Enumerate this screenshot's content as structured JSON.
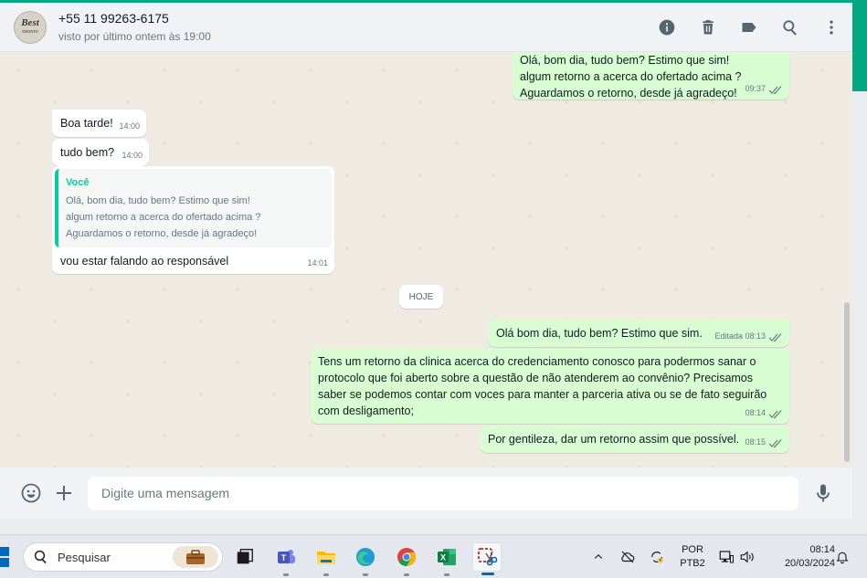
{
  "header": {
    "contact_name": "+55 11 99263-6175",
    "last_seen": "visto por último ontem às 19:00",
    "avatar_text": "Best",
    "avatar_sub": "ODONTO",
    "actions": [
      "info-icon",
      "delete-icon",
      "label-icon",
      "search-icon",
      "menu-icon"
    ]
  },
  "messages": [
    {
      "id": "m1",
      "direction": "out",
      "text": "Olá, bom dia, tudo bem? Estimo que sim!\nalgum retorno a acerca do ofertado acima ?\nAguardamos o retorno, desde já agradeço!",
      "time": "09:37",
      "status": "read"
    },
    {
      "id": "m2",
      "direction": "in",
      "text": "Boa tarde!",
      "time": "14:00"
    },
    {
      "id": "m3",
      "direction": "in",
      "text": "tudo bem?",
      "time": "14:00"
    },
    {
      "id": "m4",
      "direction": "in",
      "quote_author": "Você",
      "quote_text": "Olá, bom dia, tudo bem? Estimo que sim!\nalgum retorno a acerca do ofertado acima ?\nAguardamos o retorno, desde já agradeço!",
      "text": "vou estar falando ao responsável",
      "time": "14:01"
    },
    {
      "id": "m5",
      "direction": "out",
      "text": "Olá bom dia, tudo bem? Estimo que sim.",
      "time": "Editada 08:13",
      "status": "read"
    },
    {
      "id": "m6",
      "direction": "out",
      "text": "Tens um retorno da clinica acerca do credenciamento conosco para podermos sanar o\nprotocolo que foi aberto sobre a questão de não atenderem ao convênio? Precisamos\nsaber se podemos contar com voces para manter a parceria ativa ou se de fato seguirão\ncom desligamento;",
      "time": "08:14",
      "status": "read"
    },
    {
      "id": "m7",
      "direction": "out",
      "text": "Por gentileza, dar um retorno assim que possível.",
      "time": "08:15",
      "status": "read"
    }
  ],
  "date_separator": "HOJE",
  "composer": {
    "placeholder": "Digite uma mensagem",
    "value": ""
  },
  "taskbar": {
    "search_label": "Pesquisar",
    "apps": [
      "task-view-icon",
      "teams-icon",
      "file-explorer-icon",
      "edge-icon",
      "chrome-icon",
      "excel-icon",
      "snipping-tool-icon"
    ],
    "lang_line1": "POR",
    "lang_line2": "PTB2",
    "time": "08:14",
    "date": "20/03/2024"
  },
  "colors": {
    "accent": "#00a884",
    "outgoing_bubble": "#d9fdd3",
    "incoming_bubble": "#ffffff",
    "chat_bg": "#efeae2",
    "read_ticks": "#667781"
  }
}
